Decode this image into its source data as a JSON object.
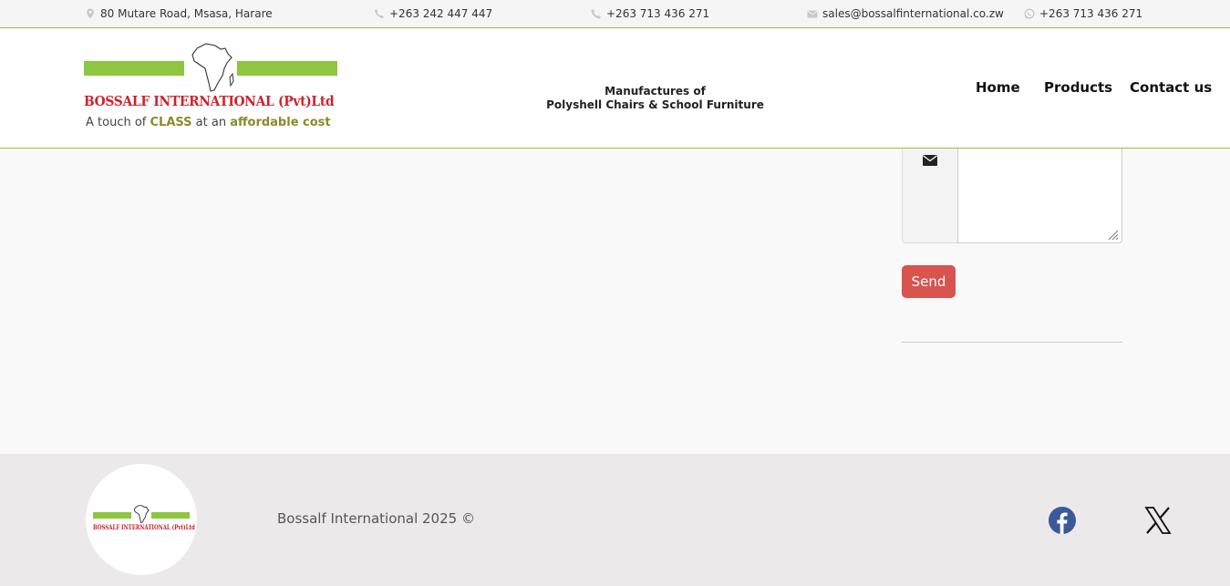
{
  "topbar": {
    "address": "80 Mutare Road, Msasa, Harare",
    "phone": "+263 242 447 447",
    "mobile": "+263 713 436 271",
    "email": "sales@bossalfinternational.co.zw",
    "whatsapp": "+263 713 436 271"
  },
  "header": {
    "logo_name": "BOSSALF INTERNATIONAL (Pvt)Ltd",
    "logo_tag_1": "A touch of ",
    "logo_tag_class": "CLASS",
    "logo_tag_2": " at an ",
    "logo_tag_affordable": "affordable cost",
    "tagline_1": "Manufactures of",
    "tagline_2": "Polyshell Chairs & School Furniture",
    "nav": [
      "Home",
      "Products",
      "Contact us"
    ]
  },
  "form": {
    "message_value": "",
    "send_label": "Send"
  },
  "footer": {
    "logo_name": "BOSSALF INTERNATIONAL (Pvt)Ltd",
    "copyright": "Bossalf International 2025 ©"
  },
  "colors": {
    "brand_green": "#8dc63f",
    "brand_red": "#d21f2a",
    "button_red": "#d9534f",
    "facebook_blue": "#3b5998"
  },
  "icons": [
    "map-marker-icon",
    "phone-icon",
    "mobile-phone-icon",
    "envelope-icon",
    "whatsapp-icon",
    "africa-map-icon",
    "facebook-icon",
    "x-twitter-icon",
    "resize-grip-icon"
  ]
}
